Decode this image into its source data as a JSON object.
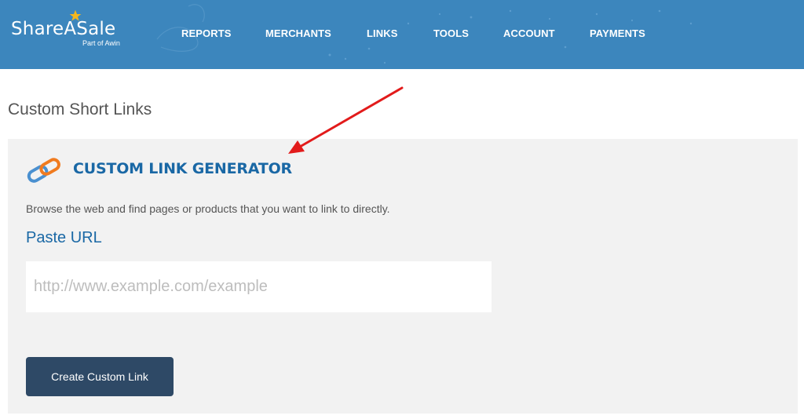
{
  "brand": {
    "name": "ShareASale",
    "tagline": "Part of Awin",
    "header_color": "#3c86bd",
    "accent_color": "#1a68a5",
    "star_color": "#f5b71c"
  },
  "nav": {
    "items": [
      {
        "label": "REPORTS"
      },
      {
        "label": "MERCHANTS"
      },
      {
        "label": "LINKS"
      },
      {
        "label": "TOOLS"
      },
      {
        "label": "ACCOUNT"
      },
      {
        "label": "PAYMENTS"
      }
    ]
  },
  "page": {
    "title": "Custom Short Links"
  },
  "generator": {
    "icon": "link-chain-icon",
    "heading": "CUSTOM LINK GENERATOR",
    "description": "Browse the web and find pages or products that you want to link to directly.",
    "url_label": "Paste URL",
    "url_value": "",
    "url_placeholder": "http://www.example.com/example",
    "button_label": "Create Custom Link",
    "button_color": "#2e4966"
  },
  "annotation": {
    "arrow_color": "#e21b1b"
  }
}
